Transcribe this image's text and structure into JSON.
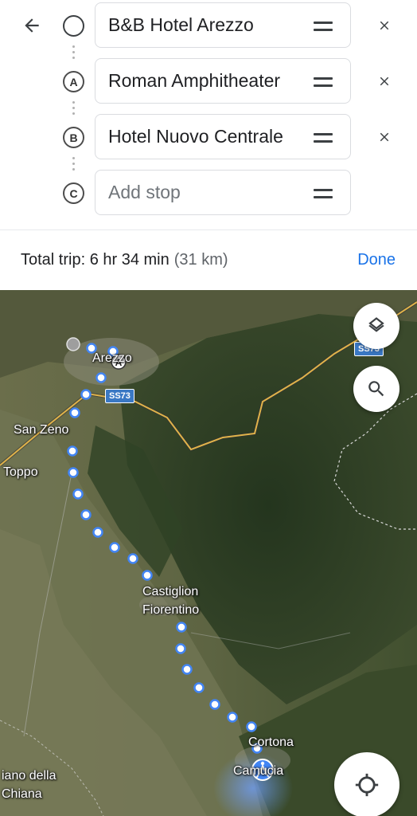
{
  "stops": [
    {
      "marker": "",
      "value": "B&B Hotel Arezzo",
      "is_placeholder": false
    },
    {
      "marker": "A",
      "value": "Roman Amphitheater",
      "is_placeholder": false
    },
    {
      "marker": "B",
      "value": "Hotel Nuovo Centrale",
      "is_placeholder": false
    },
    {
      "marker": "C",
      "value": "",
      "placeholder": "Add stop",
      "is_placeholder": true
    }
  ],
  "summary": {
    "label": "Total trip: 6 hr 34 min",
    "distance": "(31 km)",
    "done_label": "Done"
  },
  "map": {
    "labels": {
      "arezzo": "Arezzo",
      "san_zeno": "San Zeno",
      "toppo": "Toppo",
      "castiglion_1": "Castiglion",
      "castiglion_2": "Fiorentino",
      "cortona": "Cortona",
      "camucia": "Camucia",
      "foiano_1": "iano della",
      "foiano_2": "Chiana",
      "ss73_a": "SS73",
      "ss73_b": "SS73"
    },
    "route_color": "#4285f4",
    "road_color": "#e0b34a",
    "walk_marker_color": "#4285f4"
  },
  "icons": {
    "back": "arrow-left-icon",
    "layers": "layers-icon",
    "search": "search-icon",
    "locate": "my-location-icon"
  }
}
